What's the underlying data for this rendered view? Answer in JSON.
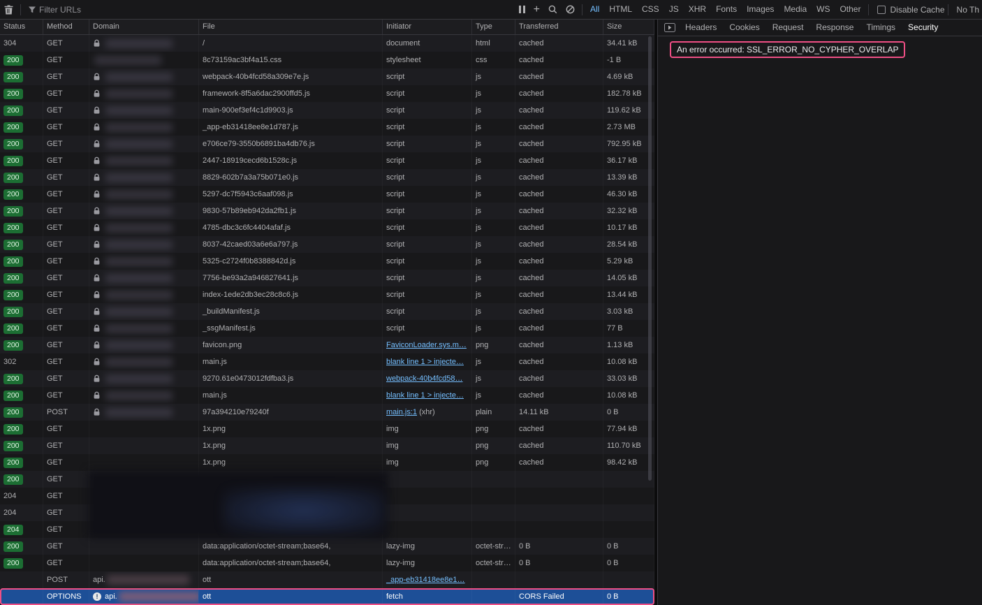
{
  "toolbar": {
    "filter_placeholder": "Filter URLs",
    "filter_tabs": [
      {
        "label": "All",
        "active": true
      },
      {
        "label": "HTML",
        "active": false
      },
      {
        "label": "CSS",
        "active": false
      },
      {
        "label": "JS",
        "active": false
      },
      {
        "label": "XHR",
        "active": false
      },
      {
        "label": "Fonts",
        "active": false
      },
      {
        "label": "Images",
        "active": false
      },
      {
        "label": "Media",
        "active": false
      },
      {
        "label": "WS",
        "active": false
      },
      {
        "label": "Other",
        "active": false
      }
    ],
    "disable_cache_label": "Disable Cache",
    "disable_cache_checked": false,
    "throttling_label": "No Th"
  },
  "icons": {
    "add": "+",
    "names": [
      "trash-icon",
      "funnel-icon",
      "pause-icon",
      "add-icon",
      "search-icon",
      "block-icon",
      "lock-icon",
      "error-icon",
      "expand-panel-icon",
      "checkbox"
    ]
  },
  "table": {
    "columns": [
      "Status",
      "Method",
      "Domain",
      "File",
      "Initiator",
      "Type",
      "Transferred",
      "Size"
    ],
    "rows": [
      {
        "status": "304",
        "badge": "plain",
        "method": "GET",
        "lock": true,
        "blur": "sm",
        "file": "/",
        "initiator": {
          "text": "document"
        },
        "type": "html",
        "transferred": "cached",
        "size": "34.41 kB"
      },
      {
        "status": "200",
        "badge": "green",
        "method": "GET",
        "blur": "sm",
        "file": "8c73159ac3bf4a15.css",
        "initiator": {
          "text": "stylesheet"
        },
        "type": "css",
        "transferred": "cached",
        "size": "-1 B"
      },
      {
        "status": "200",
        "badge": "green",
        "method": "GET",
        "lock": true,
        "blur": "sm",
        "file": "webpack-40b4fcd58a309e7e.js",
        "initiator": {
          "text": "script"
        },
        "type": "js",
        "transferred": "cached",
        "size": "4.69 kB"
      },
      {
        "status": "200",
        "badge": "green",
        "method": "GET",
        "lock": true,
        "blur": "sm",
        "file": "framework-8f5a6dac2900ffd5.js",
        "initiator": {
          "text": "script"
        },
        "type": "js",
        "transferred": "cached",
        "size": "182.78 kB"
      },
      {
        "status": "200",
        "badge": "green",
        "method": "GET",
        "lock": true,
        "blur": "sm",
        "file": "main-900ef3ef4c1d9903.js",
        "initiator": {
          "text": "script"
        },
        "type": "js",
        "transferred": "cached",
        "size": "119.62 kB"
      },
      {
        "status": "200",
        "badge": "green",
        "method": "GET",
        "lock": true,
        "blur": "sm",
        "file": "_app-eb31418ee8e1d787.js",
        "initiator": {
          "text": "script"
        },
        "type": "js",
        "transferred": "cached",
        "size": "2.73 MB"
      },
      {
        "status": "200",
        "badge": "green",
        "method": "GET",
        "lock": true,
        "blur": "sm",
        "file": "e706ce79-3550b6891ba4db76.js",
        "initiator": {
          "text": "script"
        },
        "type": "js",
        "transferred": "cached",
        "size": "792.95 kB"
      },
      {
        "status": "200",
        "badge": "green",
        "method": "GET",
        "lock": true,
        "blur": "sm",
        "file": "2447-18919cecd6b1528c.js",
        "initiator": {
          "text": "script"
        },
        "type": "js",
        "transferred": "cached",
        "size": "36.17 kB"
      },
      {
        "status": "200",
        "badge": "green",
        "method": "GET",
        "lock": true,
        "blur": "sm",
        "file": "8829-602b7a3a75b071e0.js",
        "initiator": {
          "text": "script"
        },
        "type": "js",
        "transferred": "cached",
        "size": "13.39 kB"
      },
      {
        "status": "200",
        "badge": "green",
        "method": "GET",
        "lock": true,
        "blur": "sm",
        "file": "5297-dc7f5943c6aaf098.js",
        "initiator": {
          "text": "script"
        },
        "type": "js",
        "transferred": "cached",
        "size": "46.30 kB"
      },
      {
        "status": "200",
        "badge": "green",
        "method": "GET",
        "lock": true,
        "blur": "sm",
        "file": "9830-57b89eb942da2fb1.js",
        "initiator": {
          "text": "script"
        },
        "type": "js",
        "transferred": "cached",
        "size": "32.32 kB"
      },
      {
        "status": "200",
        "badge": "green",
        "method": "GET",
        "lock": true,
        "blur": "sm",
        "file": "4785-dbc3c6fc4404afaf.js",
        "initiator": {
          "text": "script"
        },
        "type": "js",
        "transferred": "cached",
        "size": "10.17 kB"
      },
      {
        "status": "200",
        "badge": "green",
        "method": "GET",
        "lock": true,
        "blur": "sm",
        "file": "8037-42caed03a6e6a797.js",
        "initiator": {
          "text": "script"
        },
        "type": "js",
        "transferred": "cached",
        "size": "28.54 kB"
      },
      {
        "status": "200",
        "badge": "green",
        "method": "GET",
        "lock": true,
        "blur": "sm",
        "file": "5325-c2724f0b8388842d.js",
        "initiator": {
          "text": "script"
        },
        "type": "js",
        "transferred": "cached",
        "size": "5.29 kB"
      },
      {
        "status": "200",
        "badge": "green",
        "method": "GET",
        "lock": true,
        "blur": "sm",
        "file": "7756-be93a2a946827641.js",
        "initiator": {
          "text": "script"
        },
        "type": "js",
        "transferred": "cached",
        "size": "14.05 kB"
      },
      {
        "status": "200",
        "badge": "green",
        "method": "GET",
        "lock": true,
        "blur": "sm",
        "file": "index-1ede2db3ec28c8c6.js",
        "initiator": {
          "text": "script"
        },
        "type": "js",
        "transferred": "cached",
        "size": "13.44 kB"
      },
      {
        "status": "200",
        "badge": "green",
        "method": "GET",
        "lock": true,
        "blur": "sm",
        "file": "_buildManifest.js",
        "initiator": {
          "text": "script"
        },
        "type": "js",
        "transferred": "cached",
        "size": "3.03 kB"
      },
      {
        "status": "200",
        "badge": "green",
        "method": "GET",
        "lock": true,
        "blur": "sm",
        "file": "_ssgManifest.js",
        "initiator": {
          "text": "script"
        },
        "type": "js",
        "transferred": "cached",
        "size": "77 B"
      },
      {
        "status": "200",
        "badge": "green",
        "method": "GET",
        "lock": true,
        "blur": "sm",
        "file": "favicon.png",
        "initiator": {
          "text": "FaviconLoader.sys.m…",
          "link": true
        },
        "type": "png",
        "transferred": "cached",
        "size": "1.13 kB"
      },
      {
        "status": "302",
        "badge": "plain",
        "method": "GET",
        "lock": true,
        "blur": "sm",
        "file": "main.js",
        "initiator": {
          "text": "blank line 1 > injecte…",
          "link": true
        },
        "type": "js",
        "transferred": "cached",
        "size": "10.08 kB"
      },
      {
        "status": "200",
        "badge": "green",
        "method": "GET",
        "lock": true,
        "blur": "sm",
        "file": "9270.61e0473012fdfba3.js",
        "initiator": {
          "text": "webpack-40b4fcd58…",
          "link": true
        },
        "type": "js",
        "transferred": "cached",
        "size": "33.03 kB"
      },
      {
        "status": "200",
        "badge": "green",
        "method": "GET",
        "lock": true,
        "blur": "sm",
        "file": "main.js",
        "initiator": {
          "text": "blank line 1 > injecte…",
          "link": true
        },
        "type": "js",
        "transferred": "cached",
        "size": "10.08 kB"
      },
      {
        "status": "200",
        "badge": "green",
        "method": "POST",
        "lock": true,
        "blur": "sm",
        "file": "97a394210e79240f",
        "initiator": {
          "text": "main.js:1",
          "link": true,
          "suffix": " (xhr)"
        },
        "type": "plain",
        "transferred": "14.11 kB",
        "size": "0 B"
      },
      {
        "status": "200",
        "badge": "green",
        "method": "GET",
        "file": "1x.png",
        "initiator": {
          "text": "img"
        },
        "type": "png",
        "transferred": "cached",
        "size": "77.94 kB"
      },
      {
        "status": "200",
        "badge": "green",
        "method": "GET",
        "file": "1x.png",
        "initiator": {
          "text": "img"
        },
        "type": "png",
        "transferred": "cached",
        "size": "110.70 kB"
      },
      {
        "status": "200",
        "badge": "green",
        "method": "GET",
        "file": "1x.png",
        "initiator": {
          "text": "img"
        },
        "type": "png",
        "transferred": "cached",
        "size": "98.42 kB"
      },
      {
        "status": "200",
        "badge": "green",
        "method": "GET"
      },
      {
        "status": "204",
        "badge": "plain",
        "method": "GET"
      },
      {
        "status": "204",
        "badge": "plain",
        "method": "GET"
      },
      {
        "status": "204",
        "badge": "green",
        "method": "GET"
      },
      {
        "status": "200",
        "badge": "green",
        "method": "GET",
        "file": "data:application/octet-stream;base64,",
        "initiator": {
          "text": "lazy-img"
        },
        "type": "octet-str…",
        "transferred": "0 B",
        "size": "0 B"
      },
      {
        "status": "200",
        "badge": "green",
        "method": "GET",
        "file": "data:application/octet-stream;base64,",
        "initiator": {
          "text": "lazy-img"
        },
        "type": "octet-str…",
        "transferred": "0 B",
        "size": "0 B"
      },
      {
        "method": "POST",
        "domain": "api.",
        "blur": "lg",
        "file": "ott",
        "initiator": {
          "text": "_app-eb31418ee8e1…",
          "link": true
        }
      },
      {
        "method": "OPTIONS",
        "info": true,
        "domain": "api.",
        "blur": "lg",
        "file": "ott",
        "initiator": {
          "text": "fetch"
        },
        "transferred": "CORS Failed",
        "size": "0 B",
        "selected": true
      }
    ]
  },
  "details": {
    "tabs": [
      {
        "label": "Headers",
        "active": false
      },
      {
        "label": "Cookies",
        "active": false
      },
      {
        "label": "Request",
        "active": false
      },
      {
        "label": "Response",
        "active": false
      },
      {
        "label": "Timings",
        "active": false
      },
      {
        "label": "Security",
        "active": true
      }
    ],
    "error_message": "An error occurred: SSL_ERROR_NO_CYPHER_OVERLAP"
  },
  "colors": {
    "accent_blue": "#75bfff",
    "selection_blue": "#1d4f97",
    "status_green": "#1c6e33",
    "annotation_pink": "#ef4f85"
  }
}
